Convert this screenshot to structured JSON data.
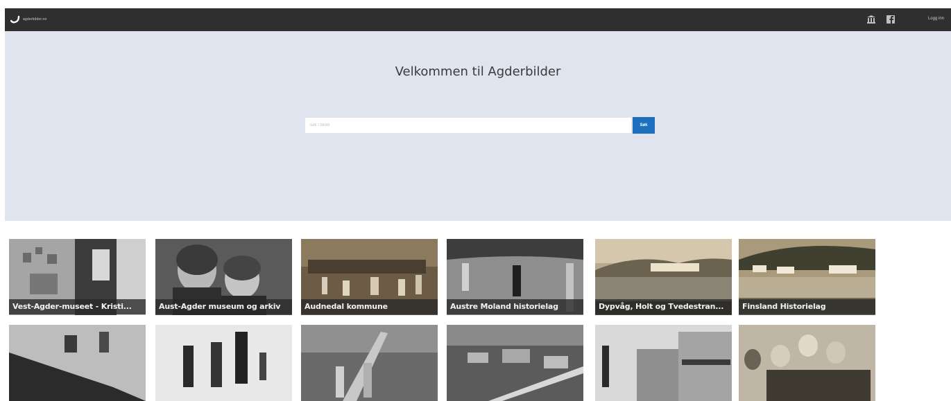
{
  "topbar": {
    "logo_text": "agderbilder.no",
    "icons": [
      "museum-icon",
      "facebook-icon"
    ],
    "login_label": "Logg inn"
  },
  "hero": {
    "title": "Velkommen til Agderbilder",
    "search_placeholder": "Søk i bilder",
    "search_button": "Søk",
    "background": "#dfe4ef"
  },
  "colors": {
    "topbar": "#2f2f2f",
    "accent": "#1f6fc0"
  },
  "collections": [
    {
      "label": "Vest-Agder-museet - Kristi..."
    },
    {
      "label": "Aust-Agder museum og arkiv"
    },
    {
      "label": "Audnedal kommune"
    },
    {
      "label": "Austre Moland historielag"
    },
    {
      "label": "Dypvåg, Holt og Tvedestran..."
    },
    {
      "label": "Finsland Historielag"
    },
    {
      "label": ""
    },
    {
      "label": ""
    },
    {
      "label": ""
    },
    {
      "label": ""
    },
    {
      "label": ""
    },
    {
      "label": ""
    }
  ]
}
